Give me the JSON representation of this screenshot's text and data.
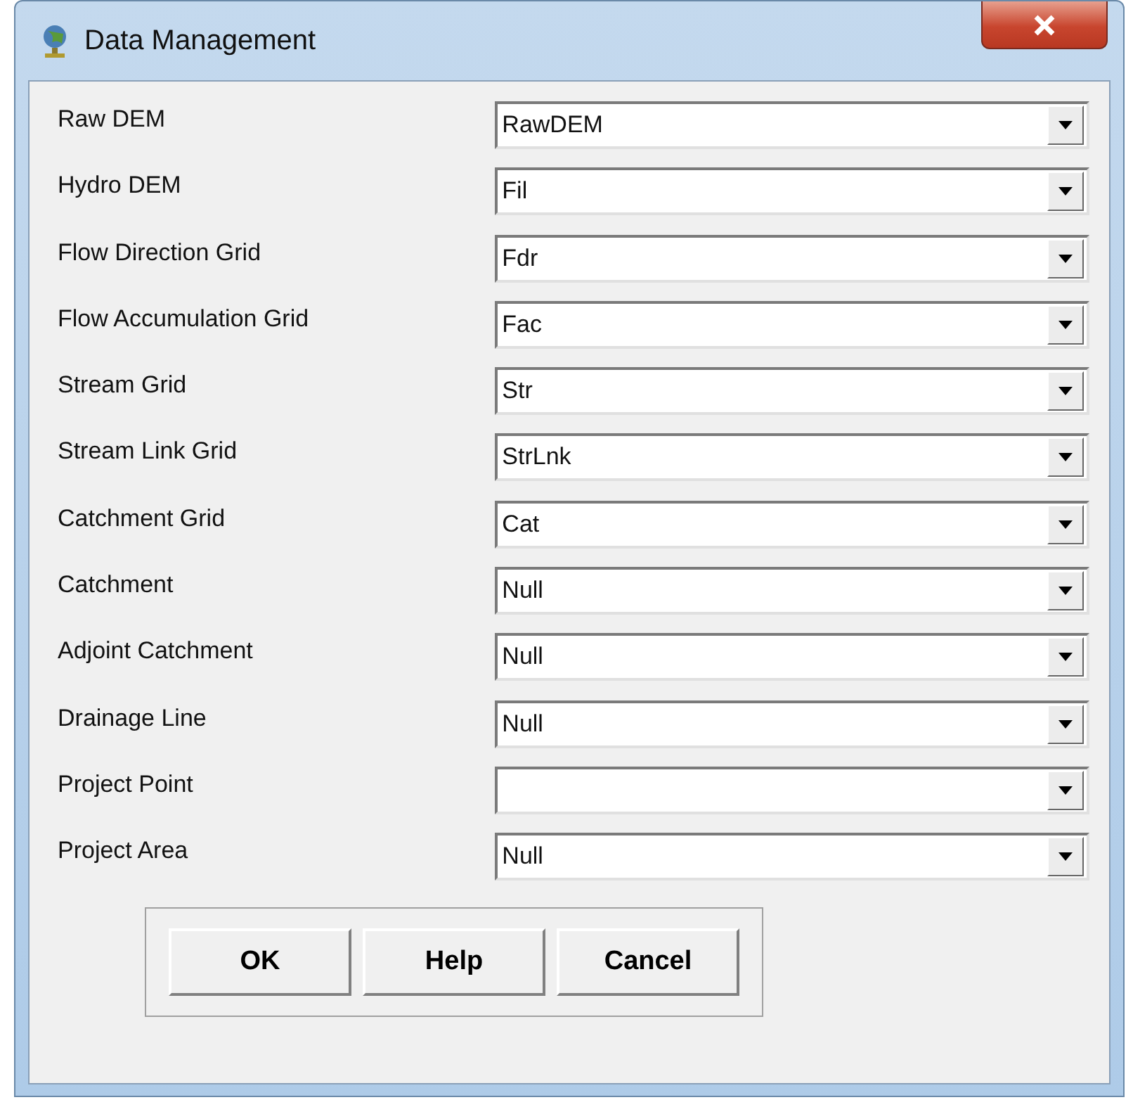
{
  "window": {
    "title": "Data Management"
  },
  "fields": [
    {
      "label": "Raw DEM",
      "value": "RawDEM"
    },
    {
      "label": "Hydro DEM",
      "value": "Fil"
    },
    {
      "label": "Flow Direction Grid",
      "value": "Fdr"
    },
    {
      "label": "Flow Accumulation Grid",
      "value": "Fac"
    },
    {
      "label": "Stream Grid",
      "value": "Str"
    },
    {
      "label": "Stream Link Grid",
      "value": "StrLnk"
    },
    {
      "label": "Catchment Grid",
      "value": "Cat"
    },
    {
      "label": "Catchment",
      "value": "Null"
    },
    {
      "label": "Adjoint Catchment",
      "value": "Null"
    },
    {
      "label": "Drainage Line",
      "value": "Null"
    },
    {
      "label": "Project Point"
    },
    {
      "label": "Project Area",
      "value": "Null"
    }
  ],
  "buttons": [
    "OK",
    "Help",
    "Cancel"
  ]
}
